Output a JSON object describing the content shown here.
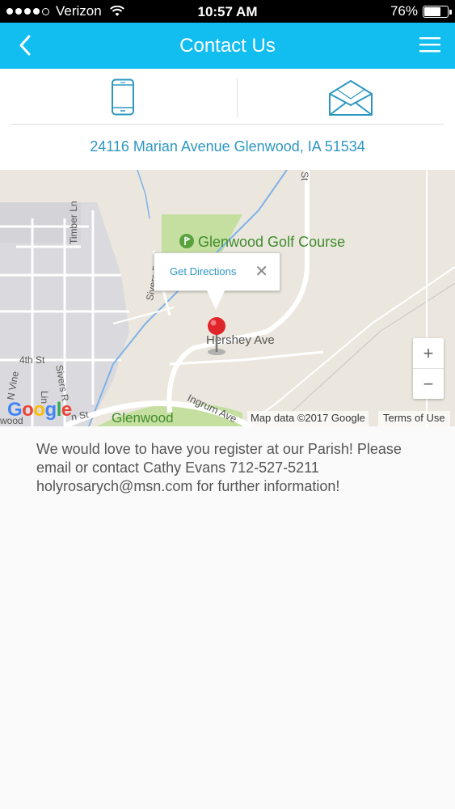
{
  "status_bar": {
    "carrier": "Verizon",
    "time": "10:57 AM",
    "battery": "76%",
    "battery_level": 0.76
  },
  "nav": {
    "title": "Contact Us",
    "back_icon": "chevron-left-icon",
    "menu_icon": "hamburger-menu-icon"
  },
  "contact": {
    "phone_icon": "phone-icon",
    "email_icon": "envelope-icon",
    "address": "24116 Marian Avenue Glenwood, IA 51534"
  },
  "map": {
    "labels": {
      "golf_course": "Glenwood Golf Course",
      "hershey": "Hershey Ave",
      "glenwood": "Glenwood",
      "timber": "Timber Ln",
      "sivers_rd": "Sivers Rd",
      "fourth_st": "4th St",
      "n_vine": "N Vine",
      "sivers_r": "Sivers R",
      "ingrum": "Ingrum Ave",
      "line": "Lin",
      "wood": "wood",
      "st_bottom": "n St",
      "st_right": "St"
    },
    "popup": {
      "text": "Get Directions",
      "close": "✕"
    },
    "zoom_in": "+",
    "zoom_out": "−",
    "google": "Google",
    "credit": "Map data ©2017 Google",
    "terms": "Terms of Use",
    "colors": {
      "land": "#ebe7de",
      "town": "#d8d8db",
      "green": "#c5dfa0",
      "water": "#7fb1e8",
      "road": "#ffffff",
      "pin": "#e0262b"
    }
  },
  "info": {
    "text": "We would love to have you register at our Parish! Please email or contact Cathy Evans 712-527-5211 holyrosarych@msn.com  for further information!"
  }
}
